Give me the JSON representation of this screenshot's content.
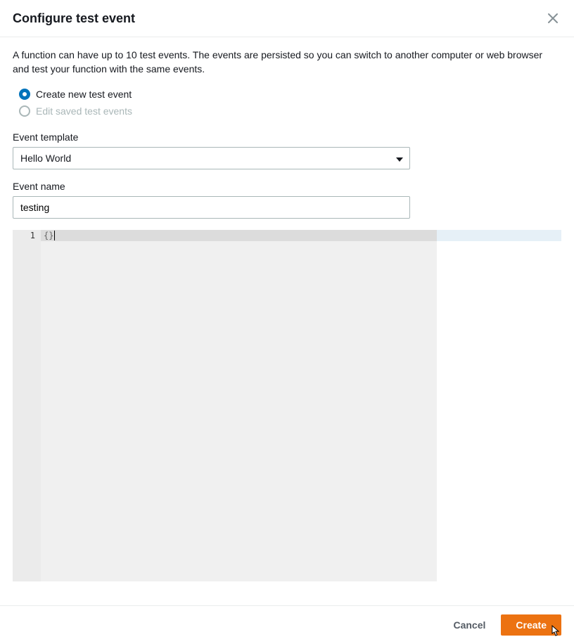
{
  "header": {
    "title": "Configure test event"
  },
  "intro": "A function can have up to 10 test events. The events are persisted so you can switch to another computer or web browser and test your function with the same events.",
  "radios": {
    "create_label": "Create new test event",
    "edit_label": "Edit saved test events",
    "selected": "create"
  },
  "template": {
    "label": "Event template",
    "value": "Hello World"
  },
  "event_name": {
    "label": "Event name",
    "value": "testing"
  },
  "editor": {
    "line_number": "1",
    "content": "{}"
  },
  "footer": {
    "cancel": "Cancel",
    "create": "Create"
  }
}
